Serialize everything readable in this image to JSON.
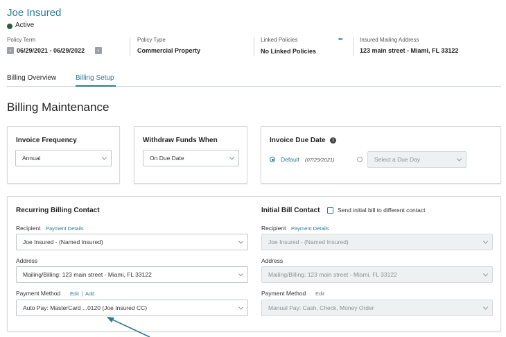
{
  "header": {
    "title": "Joe Insured",
    "status": "Active",
    "policy_term_label": "Policy Term",
    "policy_term_value": "06/29/2021 - 06/29/2022",
    "policy_type_label": "Policy Type",
    "policy_type_value": "Commercial Property",
    "linked_policies_label": "Linked Policies",
    "linked_policies_value": "No Linked Policies",
    "mailing_label": "Insured Mailing Address",
    "mailing_value": "123 main street - Miami, FL 33122",
    "more_glyph": "•••",
    "prev_glyph": "‹",
    "next_glyph": "›"
  },
  "tabs": [
    {
      "label": "Billing Overview"
    },
    {
      "label": "Billing Setup"
    }
  ],
  "section_title": "Billing Maintenance",
  "invoice_frequency": {
    "title": "Invoice Frequency",
    "value": "Annual"
  },
  "withdraw_funds": {
    "title": "Withdraw Funds When",
    "value": "On Due Date"
  },
  "invoice_due_date": {
    "title": "Invoice Due Date",
    "default_label": "Default",
    "default_date": "(07/29/2021)",
    "select_placeholder": "Select a Due Day",
    "info_glyph": "i"
  },
  "recurring_contact": {
    "title": "Recurring Billing Contact",
    "recipient_label": "Recipient",
    "payment_details_link": "Payment Details",
    "recipient_value": "Joe Insured - (Named Insured)",
    "address_label": "Address",
    "address_value": "Mailing/Billing: 123 main street  - Miami, FL 33122",
    "payment_method_label": "Payment Method",
    "edit_link": "Edit",
    "link_separator": "|",
    "add_link": "Add",
    "payment_method_value": "Auto Pay: MasterCard  ...0120 (Joe Insured CC)"
  },
  "initial_contact": {
    "title": "Initial Bill Contact",
    "checkbox_label": "Send initial bill to different contact",
    "recipient_label": "Recipient",
    "payment_details_link": "Payment Details",
    "recipient_value": "Joe Insured - (Named Insured)",
    "address_label": "Address",
    "address_value": "Mailing/Billing: 123 main street  - Miami, FL 33122",
    "payment_method_label": "Payment Method",
    "edit_link": "Edit",
    "payment_method_value": "Manual Pay: Cash, Check, Money Order"
  },
  "colors": {
    "accent": "#2b7b8c",
    "status_active": "#2f5d3a",
    "arrow": "#2b7b8c"
  },
  "icons": [
    "chevron-left-icon",
    "chevron-right-icon",
    "more-dots-icon",
    "info-icon",
    "chevron-down-icon",
    "pointer-arrow-icon"
  ]
}
